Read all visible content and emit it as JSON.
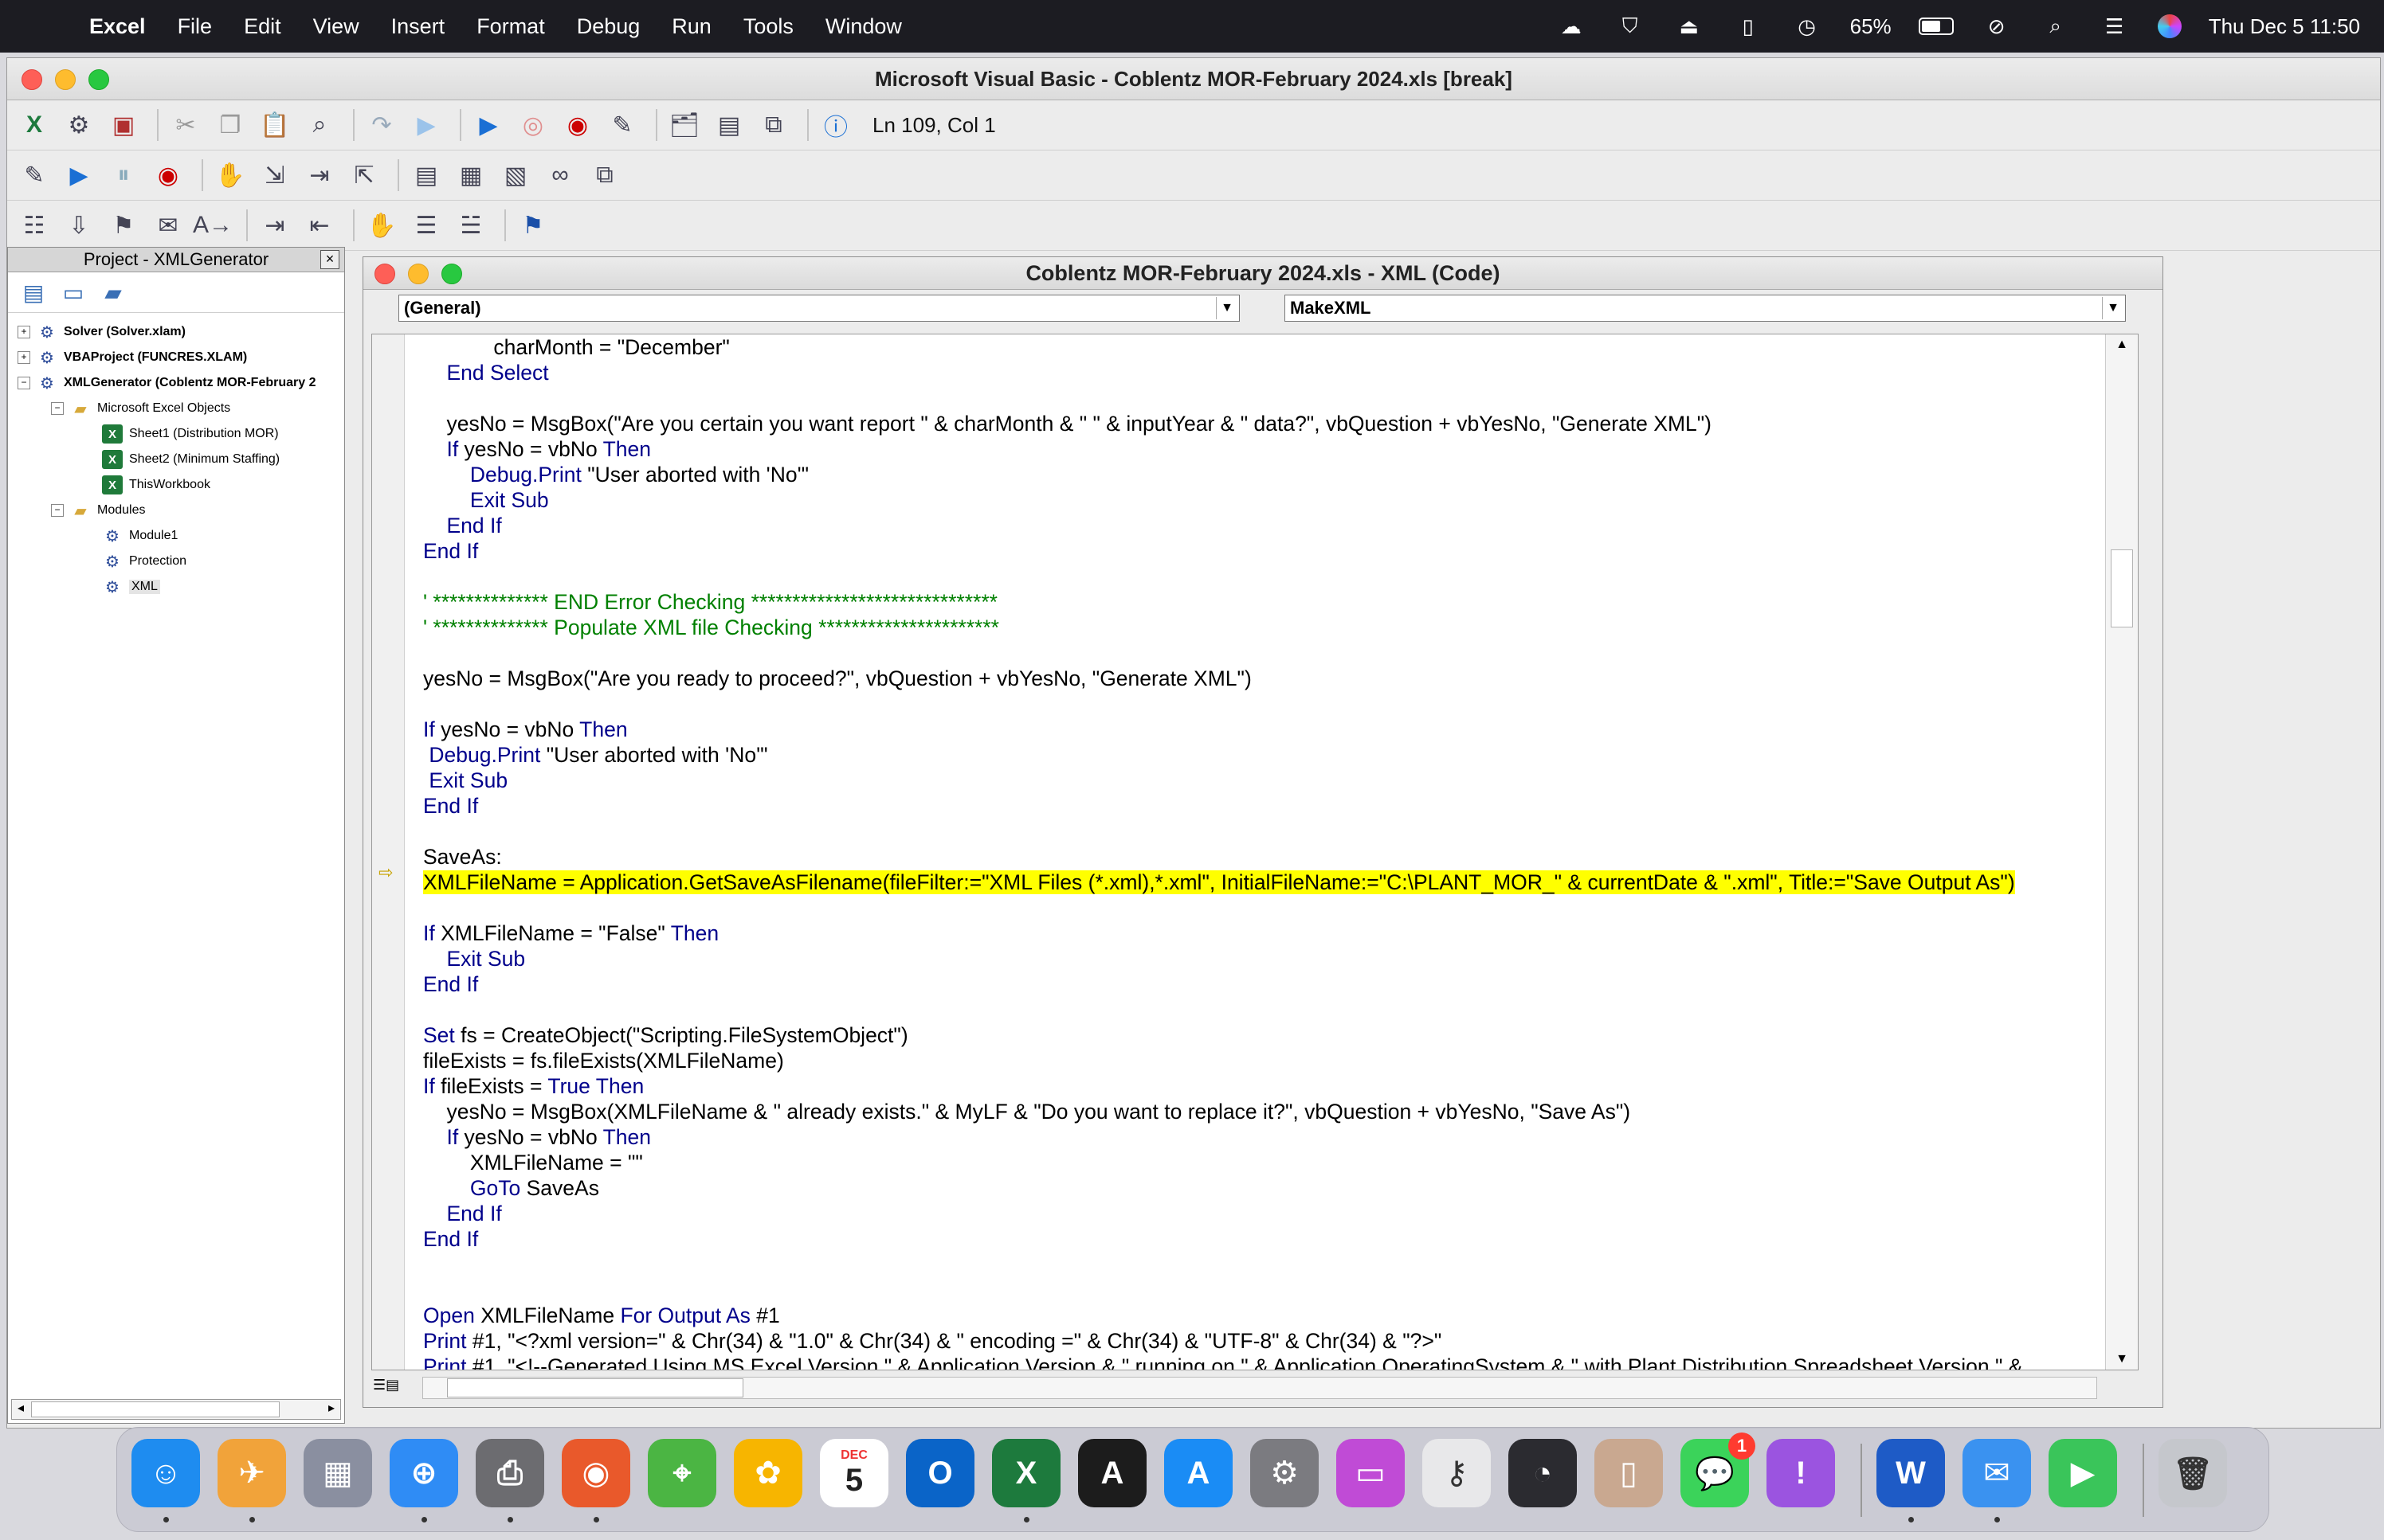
{
  "menubar": {
    "app": "Excel",
    "items": [
      "File",
      "Edit",
      "View",
      "Insert",
      "Format",
      "Debug",
      "Run",
      "Tools",
      "Window"
    ],
    "battery": "65%",
    "battery_level": 0.65,
    "datetime": "Thu Dec 5  11:50"
  },
  "vbe": {
    "title": "Microsoft Visual Basic - Coblentz MOR-February 2024.xls [break]",
    "cursor_position": "Ln 109, Col 1"
  },
  "project": {
    "title": "Project - XMLGenerator",
    "close": "×",
    "tree": [
      {
        "label": "Solver (Solver.xlam)",
        "depth": 0,
        "type": "project",
        "expander": "+",
        "bold": true
      },
      {
        "label": "VBAProject (FUNCRES.XLAM)",
        "depth": 0,
        "type": "project",
        "expander": "+",
        "bold": true
      },
      {
        "label": "XMLGenerator (Coblentz MOR-February 2",
        "depth": 0,
        "type": "project",
        "expander": "−",
        "bold": true
      },
      {
        "label": "Microsoft Excel Objects",
        "depth": 1,
        "type": "folder",
        "expander": "−",
        "bold": false
      },
      {
        "label": "Sheet1 (Distribution MOR)",
        "depth": 2,
        "type": "sheet",
        "expander": "",
        "bold": false
      },
      {
        "label": "Sheet2 (Minimum Staffing)",
        "depth": 2,
        "type": "sheet",
        "expander": "",
        "bold": false
      },
      {
        "label": "ThisWorkbook",
        "depth": 2,
        "type": "sheet",
        "expander": "",
        "bold": false
      },
      {
        "label": "Modules",
        "depth": 1,
        "type": "folder",
        "expander": "−",
        "bold": false
      },
      {
        "label": "Module1",
        "depth": 2,
        "type": "module",
        "expander": "",
        "bold": false
      },
      {
        "label": "Protection",
        "depth": 2,
        "type": "module",
        "expander": "",
        "bold": false
      },
      {
        "label": "XML",
        "depth": 2,
        "type": "module",
        "expander": "",
        "bold": false,
        "selected": true
      }
    ]
  },
  "code_window": {
    "title": "Coblentz MOR-February 2024.xls - XML (Code)",
    "object_combo": "(General)",
    "procedure_combo": "MakeXML",
    "lines": [
      [
        {
          "t": "            charMonth = \"December\""
        }
      ],
      [
        {
          "t": "    "
        },
        {
          "t": "End Select",
          "c": "kw"
        }
      ],
      [],
      [
        {
          "t": "    yesNo = MsgBox(\"Are you certain you want report \" & charMonth & \" \" & inputYear & \" data?\", vbQuestion + vbYesNo, \"Generate XML\")"
        }
      ],
      [
        {
          "t": "    "
        },
        {
          "t": "If",
          "c": "kw"
        },
        {
          "t": " yesNo = vbNo "
        },
        {
          "t": "Then",
          "c": "kw"
        }
      ],
      [
        {
          "t": "        "
        },
        {
          "t": "Debug.Print",
          "c": "kw"
        },
        {
          "t": " \"User aborted with 'No'\""
        }
      ],
      [
        {
          "t": "        "
        },
        {
          "t": "Exit Sub",
          "c": "kw"
        }
      ],
      [
        {
          "t": "    "
        },
        {
          "t": "End If",
          "c": "kw"
        }
      ],
      [
        {
          "t": "End If",
          "c": "kw"
        }
      ],
      [],
      [
        {
          "t": "' ************** END Error Checking ******************************",
          "c": "cm"
        }
      ],
      [
        {
          "t": "' ************** Populate XML file Checking **********************",
          "c": "cm"
        }
      ],
      [],
      [
        {
          "t": "yesNo = MsgBox(\"Are you ready to proceed?\", vbQuestion + vbYesNo, \"Generate XML\")"
        }
      ],
      [],
      [
        {
          "t": "If",
          "c": "kw"
        },
        {
          "t": " yesNo = vbNo "
        },
        {
          "t": "Then",
          "c": "kw"
        }
      ],
      [
        {
          "t": " "
        },
        {
          "t": "Debug.Print",
          "c": "kw"
        },
        {
          "t": " \"User aborted with 'No'\""
        }
      ],
      [
        {
          "t": " "
        },
        {
          "t": "Exit Sub",
          "c": "kw"
        }
      ],
      [
        {
          "t": "End If",
          "c": "kw"
        }
      ],
      [],
      [
        {
          "t": "SaveAs:"
        }
      ],
      [
        {
          "t": "XMLFileName = Application.GetSaveAsFilename(fileFilter:=\"XML Files (*.xml),*.xml\", InitialFileName:=\"C:\\PLANT_MOR_\" & currentDate & \".xml\", Title:=\"Save Output As\")",
          "c": "hl"
        }
      ],
      [],
      [
        {
          "t": "If",
          "c": "kw"
        },
        {
          "t": " XMLFileName = \"False\" "
        },
        {
          "t": "Then",
          "c": "kw"
        }
      ],
      [
        {
          "t": "    "
        },
        {
          "t": "Exit Sub",
          "c": "kw"
        }
      ],
      [
        {
          "t": "End If",
          "c": "kw"
        }
      ],
      [],
      [
        {
          "t": "Set",
          "c": "kw"
        },
        {
          "t": " fs = CreateObject(\"Scripting.FileSystemObject\")"
        }
      ],
      [
        {
          "t": "fileExists = fs.fileExists(XMLFileName)"
        }
      ],
      [
        {
          "t": "If",
          "c": "kw"
        },
        {
          "t": " fileExists = "
        },
        {
          "t": "True",
          "c": "kw"
        },
        {
          "t": " "
        },
        {
          "t": "Then",
          "c": "kw"
        }
      ],
      [
        {
          "t": "    yesNo = MsgBox(XMLFileName & \" already exists.\" & MyLF & \"Do you want to replace it?\", vbQuestion + vbYesNo, \"Save As\")"
        }
      ],
      [
        {
          "t": "    "
        },
        {
          "t": "If",
          "c": "kw"
        },
        {
          "t": " yesNo = vbNo "
        },
        {
          "t": "Then",
          "c": "kw"
        }
      ],
      [
        {
          "t": "        XMLFileName = \"\""
        }
      ],
      [
        {
          "t": "        "
        },
        {
          "t": "GoTo",
          "c": "kw"
        },
        {
          "t": " SaveAs"
        }
      ],
      [
        {
          "t": "    "
        },
        {
          "t": "End If",
          "c": "kw"
        }
      ],
      [
        {
          "t": "End If",
          "c": "kw"
        }
      ],
      [],
      [],
      [
        {
          "t": "Open",
          "c": "kw"
        },
        {
          "t": " XMLFileName "
        },
        {
          "t": "For Output As",
          "c": "kw"
        },
        {
          "t": " #1"
        }
      ],
      [
        {
          "t": "Print",
          "c": "kw"
        },
        {
          "t": " #1, \"<?xml version=\" & Chr(34) & \"1.0\" & Chr(34) & \" encoding =\" & Chr(34) & \"UTF-8\" & Chr(34) & \"?>\""
        }
      ],
      [
        {
          "t": "Print",
          "c": "kw"
        },
        {
          "t": " #1, \"<!--Generated Using MS Excel Version \" & Application.Version & \" running on \" & Application.OperatingSystem & \" with Plant Distribution Spreadsheet Version \" &"
        }
      ]
    ]
  },
  "dock": {
    "apps": [
      {
        "name": "finder-icon",
        "glyph": "☺",
        "color": "#1e8cf0",
        "dot": true
      },
      {
        "name": "cyberduck-icon",
        "glyph": "✈",
        "color": "#f1a33a",
        "dot": true
      },
      {
        "name": "launchpad-icon",
        "glyph": "▦",
        "color": "#8a8fa0",
        "dot": false
      },
      {
        "name": "safari-icon",
        "glyph": "⊕",
        "color": "#2f8cf5",
        "dot": true
      },
      {
        "name": "printer-icon",
        "glyph": "⎙",
        "color": "#6c6c70",
        "dot": true
      },
      {
        "name": "firefox-icon",
        "glyph": "◉",
        "color": "#e9592b",
        "dot": true
      },
      {
        "name": "maps-icon",
        "glyph": "⌖",
        "color": "#4bb543",
        "dot": false
      },
      {
        "name": "photos-icon",
        "glyph": "✿",
        "color": "#f7b500",
        "dot": false
      },
      {
        "name": "calendar-icon",
        "glyph": "5",
        "color": "#ffffff",
        "dot": false
      },
      {
        "name": "outlook-icon",
        "glyph": "O",
        "color": "#0a64c8",
        "dot": false
      },
      {
        "name": "excel-icon",
        "glyph": "X",
        "color": "#1d7a3d",
        "dot": true
      },
      {
        "name": "acrobat-icon",
        "glyph": "A",
        "color": "#1c1c1c",
        "dot": false
      },
      {
        "name": "app-store-icon",
        "glyph": "A",
        "color": "#1a8cf5",
        "dot": false
      },
      {
        "name": "system-settings-icon",
        "glyph": "⚙",
        "color": "#7b7b80",
        "dot": false
      },
      {
        "name": "disk-utility-icon",
        "glyph": "▭",
        "color": "#c04bd6",
        "dot": false
      },
      {
        "name": "keychain-icon",
        "glyph": "⚷",
        "color": "#e8e8ea",
        "dot": false
      },
      {
        "name": "activity-monitor-icon",
        "glyph": "◔",
        "color": "#2b2b30",
        "dot": false
      },
      {
        "name": "iphone-mirroring-icon",
        "glyph": "▯",
        "color": "#c9a890",
        "dot": false
      },
      {
        "name": "messages-icon",
        "glyph": "💬",
        "color": "#3bd35a",
        "dot": false,
        "badge": "1"
      },
      {
        "name": "feedback-icon",
        "glyph": "!",
        "color": "#9b54e0",
        "dot": false
      },
      {
        "name": "word-icon",
        "glyph": "W",
        "color": "#1e5bc6",
        "dot": true
      },
      {
        "name": "mail-icon",
        "glyph": "✉",
        "color": "#3a92f0",
        "dot": true
      },
      {
        "name": "facetime-icon",
        "glyph": "▶",
        "color": "#3ac55a",
        "dot": false
      },
      {
        "name": "trash-icon",
        "glyph": "🗑",
        "color": "#c5c7cc",
        "dot": false
      }
    ],
    "calendar_month": "DEC"
  },
  "colors": {
    "keyword": "#00008b",
    "comment": "#008000",
    "highlight": "#ffff00"
  }
}
